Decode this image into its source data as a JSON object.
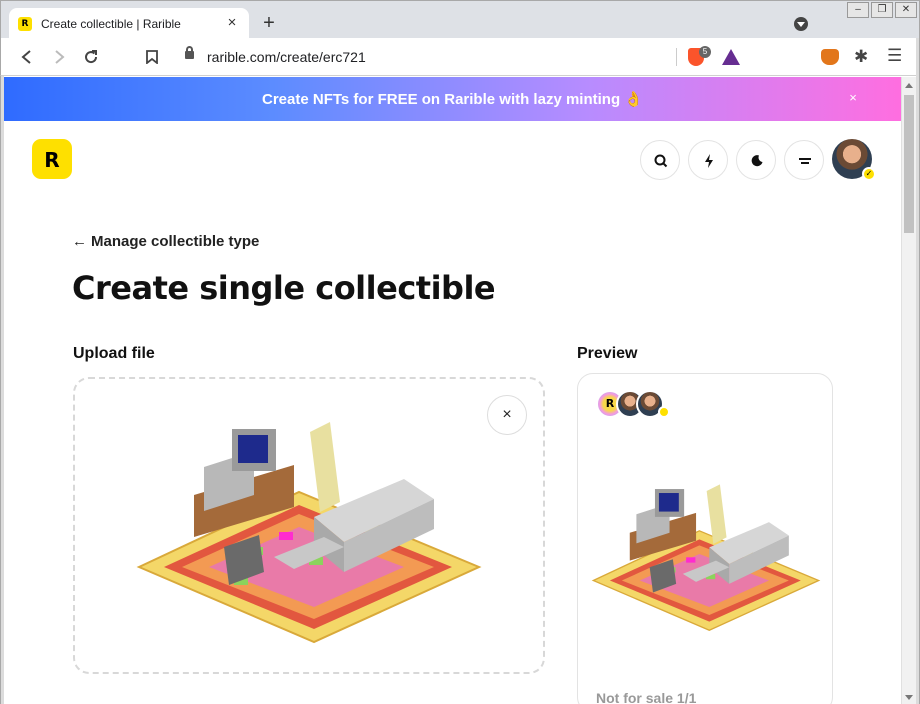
{
  "browser": {
    "tab_title": "Create collectible | Rarible",
    "tab_favicon_letter": "R",
    "url": "rarible.com/create/erc721",
    "brave_shield_count": "5",
    "icons": [
      "back-icon",
      "forward-icon",
      "reload-icon",
      "bookmark-icon",
      "lock-icon",
      "brave-shield-icon",
      "bat-rewards-icon",
      "metamask-icon",
      "extensions-icon",
      "menu-icon"
    ]
  },
  "banner": {
    "text": "Create NFTs for FREE on Rarible with lazy minting 👌",
    "close": "×",
    "colors": [
      "#2f6bff",
      "#b78cff",
      "#ff6ee0"
    ]
  },
  "header": {
    "logo_letter": "R",
    "logo_color": "#fee000",
    "buttons": [
      "search-icon",
      "lightning-icon",
      "moon-icon",
      "menu-lines-icon"
    ],
    "verified_mark": "✓"
  },
  "page": {
    "back_link": "Manage collectible type",
    "title": "Create single collectible",
    "upload_label": "Upload file",
    "preview_label": "Preview",
    "remove_file": "×",
    "preview_status": "Not for sale  1/1"
  }
}
